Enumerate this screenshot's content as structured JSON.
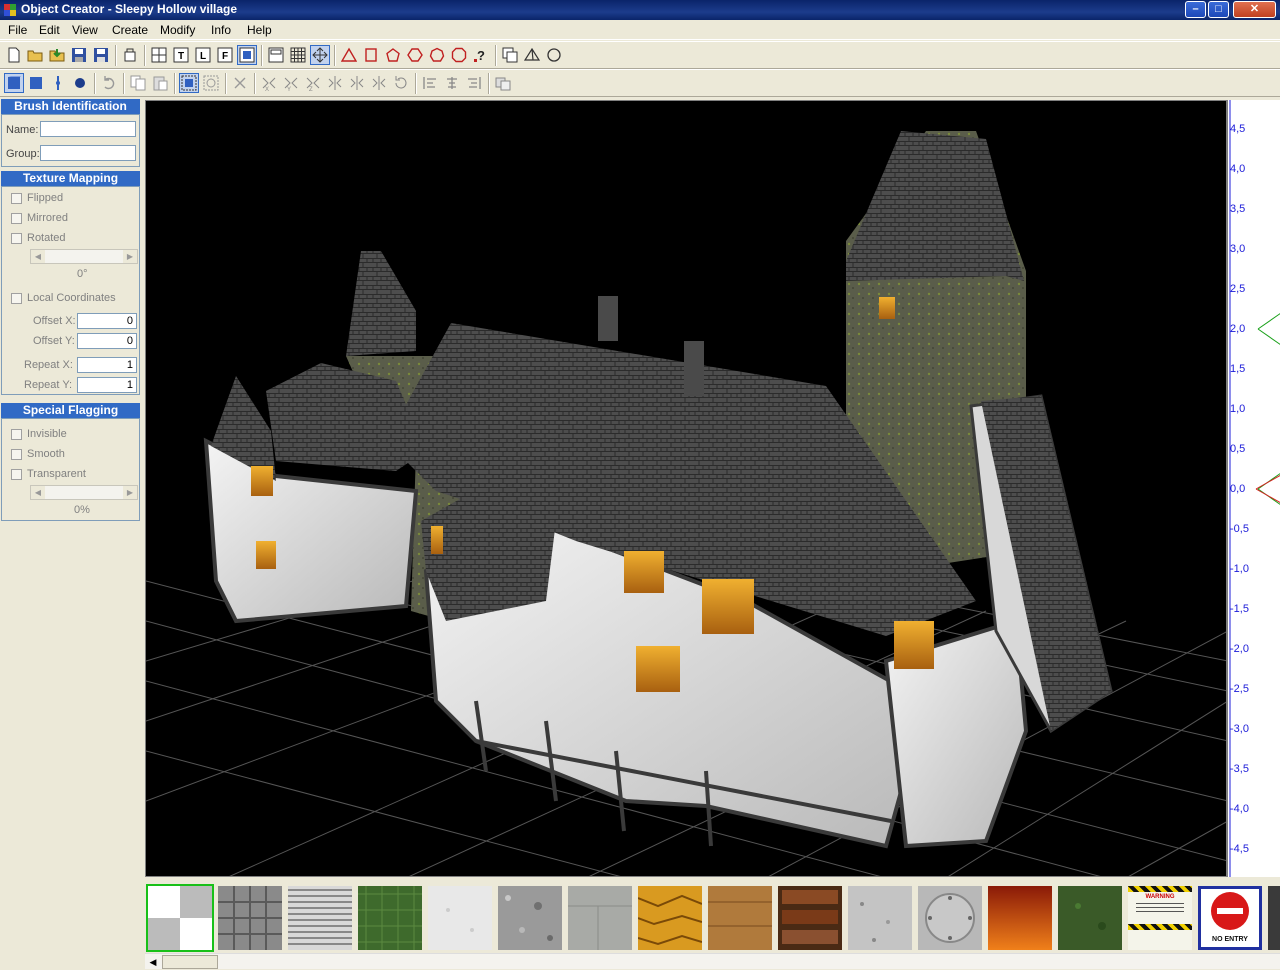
{
  "window": {
    "title": "Object Creator - Sleepy Hollow village",
    "minimize": "–",
    "maximize": "□",
    "close": "✕"
  },
  "menu": [
    "File",
    "Edit",
    "View",
    "Create",
    "Modify",
    "Info",
    "Help"
  ],
  "toolbar1": [
    {
      "name": "new-file-icon",
      "active": false
    },
    {
      "name": "open-folder-icon",
      "active": false
    },
    {
      "name": "import-icon",
      "active": false
    },
    {
      "name": "save-icon",
      "active": false
    },
    {
      "name": "save-as-icon",
      "active": false
    },
    {
      "name": "object-properties-icon",
      "active": false
    },
    {
      "name": "quad-view-icon",
      "active": false
    },
    {
      "name": "top-view-icon",
      "active": false
    },
    {
      "name": "left-view-icon",
      "active": false
    },
    {
      "name": "front-view-icon",
      "active": false
    },
    {
      "name": "perspective-view-icon",
      "active": true
    },
    {
      "name": "wireframe-icon",
      "active": false
    },
    {
      "name": "grid-icon",
      "active": false
    },
    {
      "name": "snap-icon",
      "active": false
    },
    {
      "name": "triangle-brush-icon",
      "active": false
    },
    {
      "name": "rectangle-brush-icon",
      "active": false
    },
    {
      "name": "pentagon-brush-icon",
      "active": false
    },
    {
      "name": "hexagon-brush-icon",
      "active": false
    },
    {
      "name": "heptagon-brush-icon",
      "active": false
    },
    {
      "name": "octagon-brush-icon",
      "active": false
    },
    {
      "name": "custom-polygon-icon",
      "active": false
    },
    {
      "name": "copy-brush-icon",
      "active": false
    },
    {
      "name": "pyramid-brush-icon",
      "active": false
    },
    {
      "name": "sphere-brush-icon",
      "active": false
    }
  ],
  "toolbar2": [
    {
      "name": "select-brush-icon",
      "active": true
    },
    {
      "name": "select-face-icon",
      "active": false
    },
    {
      "name": "select-edge-icon",
      "active": false
    },
    {
      "name": "select-vertex-icon",
      "active": false
    },
    {
      "name": "undo-icon",
      "active": false
    },
    {
      "name": "copy-icon",
      "active": false
    },
    {
      "name": "paste-icon",
      "active": false
    },
    {
      "name": "select-all-icon",
      "active": false
    },
    {
      "name": "deselect-icon",
      "active": false
    },
    {
      "name": "delete-icon",
      "active": false
    },
    {
      "name": "flip-x-icon",
      "active": false
    },
    {
      "name": "flip-y-icon",
      "active": false
    },
    {
      "name": "flip-z-icon",
      "active": false
    },
    {
      "name": "mirror-x-icon",
      "active": false
    },
    {
      "name": "mirror-y-icon",
      "active": false
    },
    {
      "name": "mirror-z-icon",
      "active": false
    },
    {
      "name": "rotate-icon",
      "active": false
    },
    {
      "name": "align-x-icon",
      "active": false
    },
    {
      "name": "align-y-icon",
      "active": false
    },
    {
      "name": "align-z-icon",
      "active": false
    },
    {
      "name": "texture-lock-icon",
      "active": false
    }
  ],
  "brush": {
    "heading": "Brush Identification",
    "name_label": "Name:",
    "name_value": "",
    "group_label": "Group:",
    "group_value": ""
  },
  "texture_mapping": {
    "heading": "Texture Mapping",
    "flipped": "Flipped",
    "mirrored": "Mirrored",
    "rotated": "Rotated",
    "rotation_value": "0°",
    "local_coords": "Local Coordinates",
    "offset_x_label": "Offset X:",
    "offset_x": "0",
    "offset_y_label": "Offset Y:",
    "offset_y": "0",
    "repeat_x_label": "Repeat X:",
    "repeat_x": "1",
    "repeat_y_label": "Repeat Y:",
    "repeat_y": "1"
  },
  "special_flagging": {
    "heading": "Special Flagging",
    "invisible": "Invisible",
    "smooth": "Smooth",
    "transparent": "Transparent",
    "transparency_value": "0%"
  },
  "ruler_ticks": [
    "4,5",
    "4,0",
    "3,5",
    "3,0",
    "2,5",
    "2,0",
    "1,5",
    "1,0",
    "0,5",
    "0,0",
    "-0,5",
    "-1,0",
    "-1,5",
    "-2,0",
    "-2,5",
    "-3,0",
    "-3,5",
    "-4,0",
    "-4,5"
  ],
  "textures": [
    {
      "name": "checker-texture",
      "selected": true,
      "caption": ""
    },
    {
      "name": "metal-grid-texture",
      "selected": false,
      "caption": ""
    },
    {
      "name": "stripes-texture",
      "selected": false,
      "caption": ""
    },
    {
      "name": "grass-texture",
      "selected": false,
      "caption": ""
    },
    {
      "name": "white-plaster-texture",
      "selected": false,
      "caption": ""
    },
    {
      "name": "gravel-texture",
      "selected": false,
      "caption": ""
    },
    {
      "name": "concrete-texture",
      "selected": false,
      "caption": ""
    },
    {
      "name": "gold-window-texture",
      "selected": false,
      "caption": ""
    },
    {
      "name": "wood-texture",
      "selected": false,
      "caption": ""
    },
    {
      "name": "bookshelf-texture",
      "selected": false,
      "caption": ""
    },
    {
      "name": "granite-texture",
      "selected": false,
      "caption": ""
    },
    {
      "name": "metal-plate-texture",
      "selected": false,
      "caption": ""
    },
    {
      "name": "lava-texture",
      "selected": false,
      "caption": ""
    },
    {
      "name": "moss-texture",
      "selected": false,
      "caption": ""
    },
    {
      "name": "warning-sign-texture",
      "selected": false,
      "caption": "WARNING"
    },
    {
      "name": "no-entry-sign-texture",
      "selected": false,
      "caption": "NO ENTRY"
    }
  ]
}
